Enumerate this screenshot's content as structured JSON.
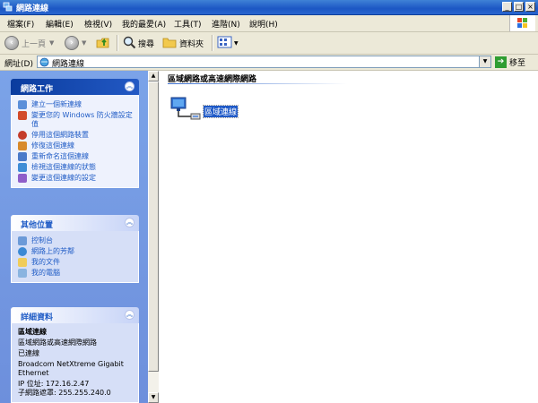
{
  "window": {
    "title": "網路連線"
  },
  "menu": [
    "檔案(F)",
    "編輯(E)",
    "檢視(V)",
    "我的最愛(A)",
    "工具(T)",
    "進階(N)",
    "說明(H)"
  ],
  "toolbar": {
    "back": "上一頁",
    "search": "搜尋",
    "folders": "資料夾"
  },
  "address": {
    "label": "網址(D)",
    "value": "網路連線",
    "go": "移至"
  },
  "tasks_panel": {
    "title": "網路工作",
    "items": [
      {
        "label": "建立一個新連線",
        "icon": "new-connection-icon"
      },
      {
        "label": "變更您的 Windows 防火牆設定值",
        "icon": "firewall-icon"
      },
      {
        "label": "停用這個網路裝置",
        "icon": "disable-device-icon"
      },
      {
        "label": "修復這個連線",
        "icon": "repair-icon"
      },
      {
        "label": "重新命名這個連線",
        "icon": "rename-icon"
      },
      {
        "label": "檢視這個連線的狀態",
        "icon": "status-icon"
      },
      {
        "label": "變更這個連線的設定",
        "icon": "settings-icon"
      }
    ]
  },
  "places_panel": {
    "title": "其他位置",
    "items": [
      {
        "label": "控制台",
        "icon": "control-panel-icon"
      },
      {
        "label": "網路上的芳鄰",
        "icon": "network-places-icon"
      },
      {
        "label": "我的文件",
        "icon": "my-documents-icon"
      },
      {
        "label": "我的電腦",
        "icon": "my-computer-icon"
      }
    ]
  },
  "details_panel": {
    "title": "詳細資料",
    "name": "區域連線",
    "lines": [
      "區域網路或高速網際網路",
      "已連線",
      "Broadcom NetXtreme Gigabit Ethernet",
      "IP 位址: 172.16.2.47",
      "子網路遮罩: 255.255.240.0"
    ]
  },
  "content": {
    "group_title": "區域網路或高速網際網路",
    "connection_label": "區域連線"
  },
  "colors": {
    "titlebar": "#1c57c4",
    "sidebar": "#6d8fdc",
    "link": "#215dc6",
    "selection": "#1f5ac8"
  }
}
